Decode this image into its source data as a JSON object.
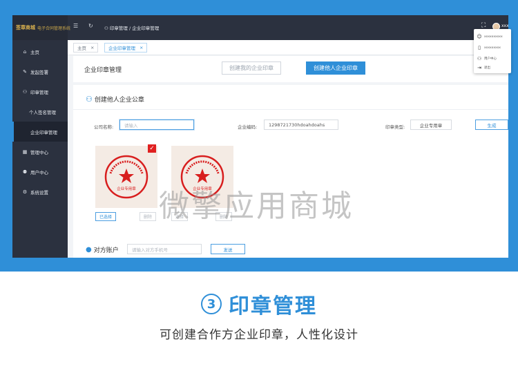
{
  "app": {
    "logo_mark": "签章商城",
    "logo_text": "电子合同管理系统"
  },
  "topbar": {
    "breadcrumb": "印章管理 / 企业印章管理",
    "icons": [
      "menu-icon",
      "refresh-icon",
      "fullscreen-icon",
      "avatar"
    ],
    "user_label": "xxx"
  },
  "user_dropdown": {
    "items": [
      {
        "icon": "user-icon",
        "label": "xxxxxxxxxx"
      },
      {
        "icon": "phone-icon",
        "label": "xxxxxxxxx"
      },
      {
        "icon": "user-center-icon",
        "label": "用户中心"
      },
      {
        "icon": "logout-icon",
        "label": "退出"
      }
    ]
  },
  "sidebar": {
    "items": [
      {
        "icon": "home-icon",
        "label": "主页"
      },
      {
        "icon": "edit-icon",
        "label": "发起签署"
      },
      {
        "icon": "user-icon",
        "label": "印章管理"
      },
      {
        "icon": "",
        "label": "个人签名管理"
      },
      {
        "icon": "",
        "label": "企业印章管理"
      },
      {
        "icon": "grid-icon",
        "label": "管理中心"
      },
      {
        "icon": "users-icon",
        "label": "用户中心"
      },
      {
        "icon": "gear-icon",
        "label": "系统设置"
      }
    ]
  },
  "tabs": [
    {
      "label": "主页",
      "close": "×"
    },
    {
      "label": "企业印章管理",
      "close": "×"
    }
  ],
  "header": {
    "title": "企业印章管理",
    "btn_my": "创建我的企业印章",
    "btn_others": "创建他人企业印章"
  },
  "form": {
    "section_title": "创建他人企业公章",
    "company_label": "公司名称:",
    "company_placeholder": "请输入",
    "code_label": "企业编码:",
    "code_value": "1298721730hdoahdoahs",
    "type_label": "印章类型:",
    "type_value": "企业专用章",
    "generate_btn": "生成",
    "seals": [
      {
        "selected": true,
        "select_label": "已选择",
        "delete_label": "删除"
      },
      {
        "selected": false,
        "select_label": "选择",
        "delete_label": "删除"
      }
    ],
    "seal_text": "企业专用章",
    "counterparty_label": "对方账户",
    "counterparty_placeholder": "请输入对方手机号",
    "send_btn": "发送"
  },
  "watermark": "微擎应用商城",
  "footer": {
    "number": "3",
    "title": "印章管理",
    "subtitle": "可创建合作方企业印章，人性化设计"
  },
  "colors": {
    "accent": "#2f8fd8",
    "sidebar_bg": "#2b313f",
    "seal_red": "#d81e1e"
  }
}
